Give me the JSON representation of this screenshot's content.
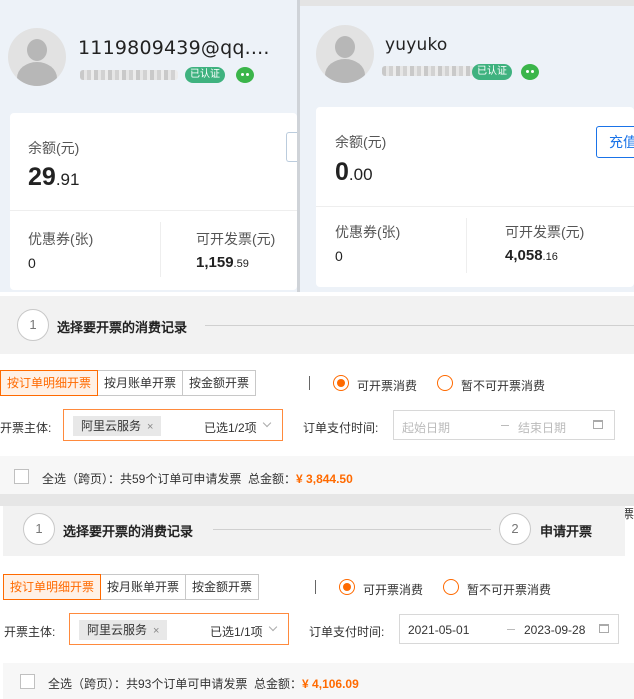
{
  "account_left": {
    "username": "1119809439@qq....",
    "verified_badge": "已认证",
    "balance_label": "余额(元)",
    "balance_int": "29",
    "balance_dec": ".91",
    "coupon_label": "优惠券(张)",
    "coupon_value": "0",
    "invoiceable_label": "可开发票(元)",
    "invoiceable_int": "1,159",
    "invoiceable_dec": ".59"
  },
  "account_right": {
    "username": "yuyuko",
    "verified_badge": "已认证",
    "balance_label": "余额(元)",
    "balance_int": "0",
    "balance_dec": ".00",
    "recharge_label": "充值",
    "coupon_label": "优惠券(张)",
    "coupon_value": "0",
    "invoiceable_label": "可开发票(元)",
    "invoiceable_int": "4,058",
    "invoiceable_dec": ".16"
  },
  "panel_a": {
    "step1_num": "1",
    "step1_title": "选择要开票的消费记录",
    "tabs": [
      "按订单明细开票",
      "按月账单开票",
      "按金额开票"
    ],
    "radio_on": "可开票消费",
    "radio_off": "暂不可开票消费",
    "entity_label": "开票主体:",
    "entity_tag": "阿里云服务",
    "tag_close": "×",
    "entity_count": "已选1/2项",
    "time_label": "订单支付时间:",
    "date_start": "起始日期",
    "date_end": "结束日期",
    "select_all": "全选（跨页）：共59个订单可申请发票",
    "total_label": "总金额：",
    "total_amount": "¥ 3,844.50",
    "edge_char": "票"
  },
  "panel_b": {
    "step1_num": "1",
    "step1_title": "选择要开票的消费记录",
    "step2_num": "2",
    "step2_title": "申请开票",
    "tabs": [
      "按订单明细开票",
      "按月账单开票",
      "按金额开票"
    ],
    "radio_on": "可开票消费",
    "radio_off": "暂不可开票消费",
    "entity_label": "开票主体:",
    "entity_tag": "阿里云服务",
    "tag_close": "×",
    "entity_count": "已选1/1项",
    "time_label": "订单支付时间:",
    "date_start": "2021-05-01",
    "date_end": "2023-09-28",
    "select_all": "全选（跨页）：共93个订单可申请发票",
    "total_label": "总金额：",
    "total_amount": "¥ 4,106.09"
  },
  "colors": {
    "accent_orange": "#ff6a00",
    "verified_green": "#3fb27f",
    "recharge_blue": "#1a73e8"
  }
}
